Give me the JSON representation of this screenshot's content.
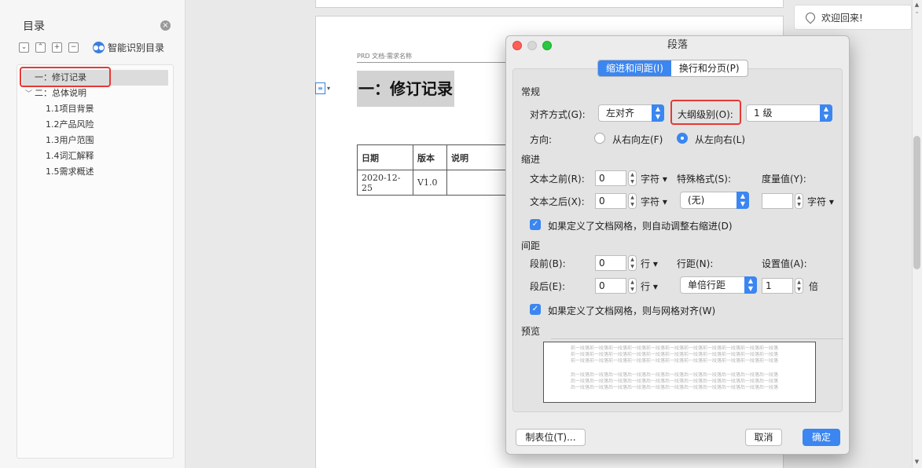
{
  "sidebar": {
    "title": "目录",
    "smart_toc_label": "智能识别目录",
    "toolbar_glyphs": [
      "⌄",
      "⌃",
      "+",
      "−"
    ],
    "items": [
      {
        "label": "一：修订记录",
        "level": 1,
        "selected": true
      },
      {
        "label": "二：总体说明",
        "level": 1,
        "expanded": true
      },
      {
        "label": "1.1项目背景",
        "level": 2
      },
      {
        "label": "1.2产品风险",
        "level": 2
      },
      {
        "label": "1.3用户范围",
        "level": 2
      },
      {
        "label": "1.4词汇解释",
        "level": 2
      },
      {
        "label": "1.5需求概述",
        "level": 2
      }
    ]
  },
  "document": {
    "header_text": "PRD 文档-需求名称",
    "heading": "一：修订记录",
    "table": {
      "headers": [
        "日期",
        "版本",
        "说明"
      ],
      "rows": [
        [
          "2020-12-25",
          "V1.0",
          ""
        ]
      ]
    }
  },
  "welcome": {
    "text": "欢迎回来!"
  },
  "dialog": {
    "title": "段落",
    "tabs": [
      {
        "label": "缩进和间距(I)",
        "active": true
      },
      {
        "label": "换行和分页(P)",
        "active": false
      }
    ],
    "general": {
      "section": "常规",
      "alignment_label": "对齐方式(G):",
      "alignment_value": "左对齐",
      "outline_label": "大纲级别(O):",
      "outline_value": "1 级",
      "direction_label": "方向:",
      "rtl_label": "从右向左(F)",
      "ltr_label": "从左向右(L)",
      "direction_selected": "ltr"
    },
    "indent": {
      "section": "缩进",
      "before_label": "文本之前(R):",
      "before_value": "0",
      "after_label": "文本之后(X):",
      "after_value": "0",
      "unit": "字符",
      "special_label": "特殊格式(S):",
      "special_value": "(无)",
      "measure_label": "度量值(Y):",
      "measure_value": "",
      "measure_unit": "字符",
      "grid_check_label": "如果定义了文档网格，则自动调整右缩进(D)",
      "grid_checked": true
    },
    "spacing": {
      "section": "间距",
      "before_label": "段前(B):",
      "before_value": "0",
      "after_label": "段后(E):",
      "after_value": "0",
      "unit": "行",
      "line_label": "行距(N):",
      "line_value": "单倍行距",
      "setting_label": "设置值(A):",
      "setting_value": "1",
      "setting_unit": "倍",
      "grid_check_label": "如果定义了文档网格，则与网格对齐(W)",
      "grid_checked": true
    },
    "preview": {
      "section": "预览",
      "prev_paragraph_text": "前一段落前一段落前一段落前一段落前一段落前一段落前一段落前一段落前一段落前一段落前一段落",
      "next_paragraph_text": "后一段落后一段落后一段落后一段落后一段落后一段落后一段落后一段落后一段落后一段落后一段落"
    },
    "buttons": {
      "tabs_button": "制表位(T)...",
      "cancel": "取消",
      "ok": "确定"
    }
  },
  "colors": {
    "accent": "#3b86f0",
    "highlight_border": "#e53935",
    "heading_bg": "#d2d2d2"
  }
}
